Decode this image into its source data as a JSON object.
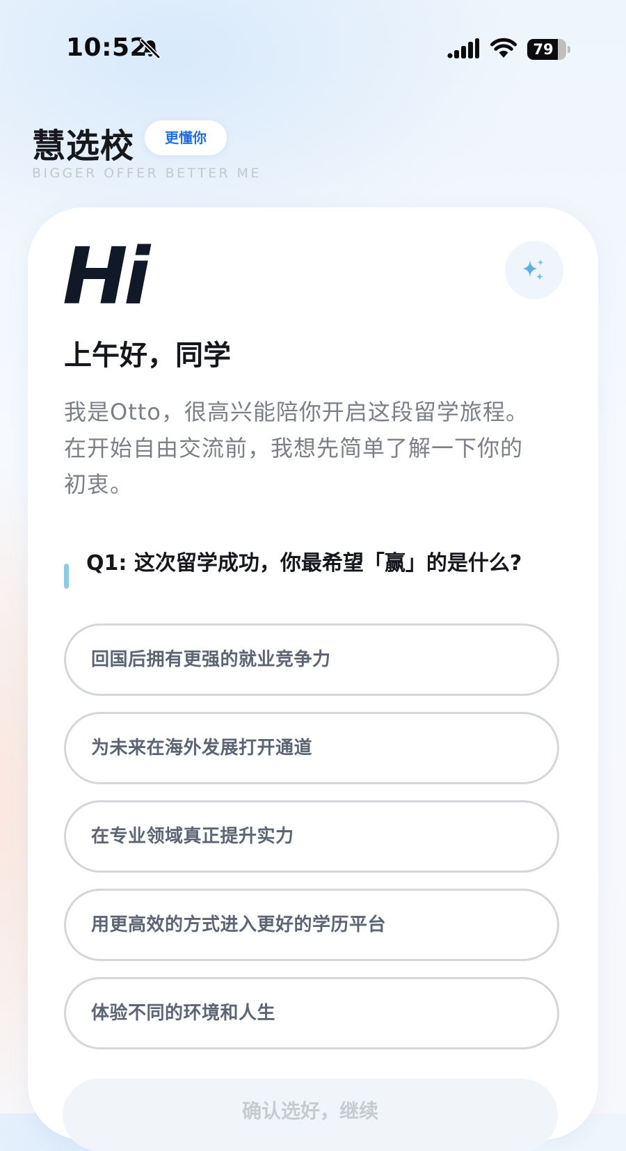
{
  "status_bar": {
    "time": "10:52",
    "battery_level": 79,
    "battery_text": "79"
  },
  "header": {
    "title": "慧选校",
    "badge": "更懂你",
    "slogan": "BIGGER OFFER BETTER ME"
  },
  "card": {
    "hi": "Hi",
    "greeting": "上午好，同学",
    "intro": "我是Otto，很高兴能陪你开启这段留学旅程。在开始自由交流前，我想先简单了解一下你的初衷。",
    "question": "Q1: 这次留学成功，你最希望「赢」的是什么?",
    "options": [
      {
        "label": "回国后拥有更强的就业竞争力"
      },
      {
        "label": "为未来在海外发展打开通道"
      },
      {
        "label": "在专业领域真正提升实力"
      },
      {
        "label": "用更高效的方式进入更好的学历平台"
      },
      {
        "label": "体验不同的环境和人生"
      }
    ],
    "confirm_label": "确认选好，继续"
  },
  "colors": {
    "accent": "#1f6fe0",
    "question_marker": "#8ccbe3",
    "sparkle": "#5fb0e0"
  }
}
